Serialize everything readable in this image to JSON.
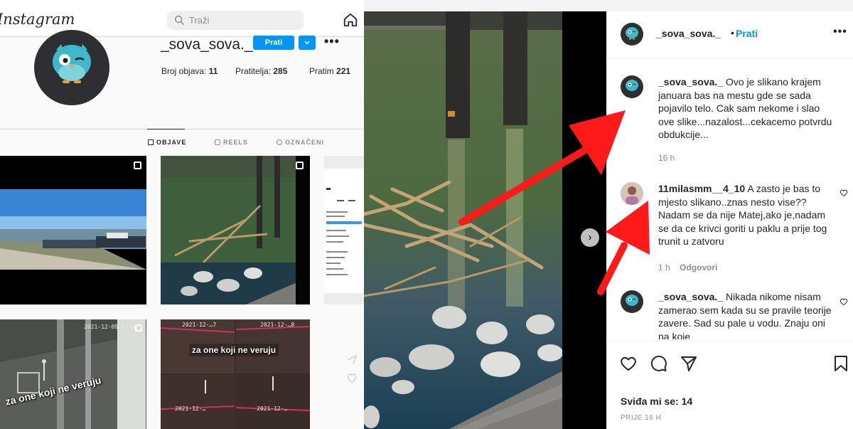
{
  "left": {
    "logo": "Instagram",
    "search_placeholder": "Traži",
    "profile": {
      "username": "_sova_sova._",
      "follow_label": "Prati",
      "stats": {
        "posts_label": "Broj objava:",
        "posts_value": "11",
        "followers_label": "Pratitelja:",
        "followers_value": "285",
        "following_label": "Pratim",
        "following_value": "221"
      }
    },
    "tabs": [
      {
        "label": "OBJAVE",
        "active": true
      },
      {
        "label": "REELS",
        "active": false
      },
      {
        "label": "OZNAČENI",
        "active": false
      }
    ],
    "thumbs": {
      "t4_stamp": "2021-12-09 11:47",
      "t4_overlay": "za one koji ne veruju",
      "t5_stamps": [
        "2021-12-…7",
        "2021-12-…8",
        "2021-12-…",
        "2021-12-…"
      ],
      "t5_overlay": "za one koji ne veruju"
    }
  },
  "post": {
    "header": {
      "username": "_sova_sova._",
      "separator": "•",
      "follow_label": "Prati"
    },
    "comments": [
      {
        "username": "_sova_sova._",
        "text": "Ovo je slikano krajem januara bas na mestu gde se sada pojavilo telo. Cak sam nekome i slao ove slike...nazalost...cekacemo potvrdu obdukcije...",
        "time": "16 h",
        "reply": ""
      },
      {
        "username": "11milasmm__4_10",
        "text": "A zasto je bas to mjesto slikano..znas nesto vise??Nadam se da nije Matej,ako je,nadam se da ce krivci goriti u paklu a prije tog trunit u zatvoru",
        "time": "1 h",
        "reply": "Odgovori"
      },
      {
        "username": "_sova_sova._",
        "text": "Nikada nikome nisam zamerao sem kada su se pravile teorije zavere. Sad su pale u vodu. Znaju oni na koje",
        "time": "",
        "reply": ""
      }
    ],
    "likes": "Sviđa mi se: 14",
    "ago": "PRIJE 16 H"
  },
  "colors": {
    "accent": "#0095f6",
    "arrow": "#ff1a1a"
  }
}
